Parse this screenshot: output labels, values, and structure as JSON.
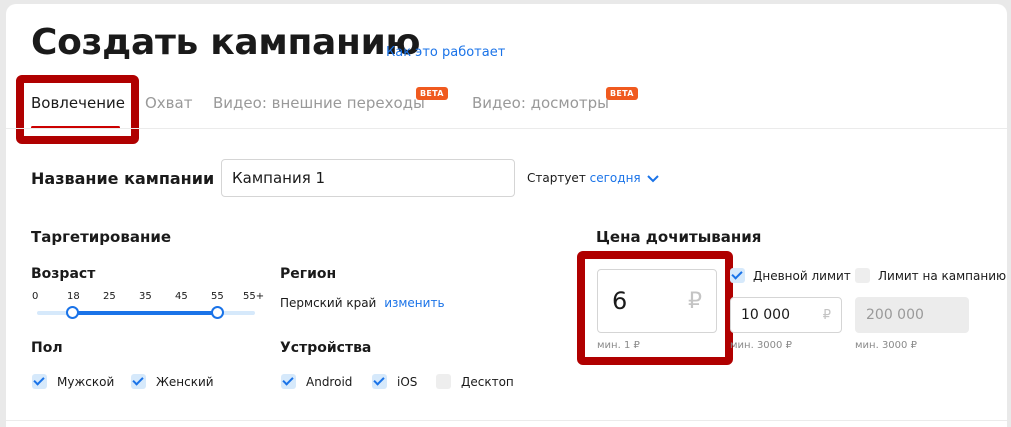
{
  "header": {
    "title": "Создать кампанию",
    "how_it_works": "Как это работает"
  },
  "tabs": [
    {
      "label": "Вовлечение",
      "active": true
    },
    {
      "label": "Охват"
    },
    {
      "label": "Видео: внешние переходы",
      "badge": "BETA"
    },
    {
      "label": "Видео: досмотры",
      "badge": "BETA"
    }
  ],
  "campaign": {
    "name_label": "Название кампании",
    "name_value": "Кампания 1",
    "starts_label": "Стартует",
    "starts_value": "сегодня"
  },
  "targeting": {
    "title": "Таргетирование",
    "age": {
      "label": "Возраст",
      "ticks": [
        "0",
        "18",
        "25",
        "35",
        "45",
        "55",
        "55+"
      ],
      "selected_min": "18",
      "selected_max": "55"
    },
    "region": {
      "label": "Регион",
      "value": "Пермский край",
      "change": "изменить"
    },
    "gender": {
      "label": "Пол",
      "options": [
        {
          "label": "Мужской",
          "checked": true
        },
        {
          "label": "Женский",
          "checked": true
        }
      ]
    },
    "devices": {
      "label": "Устройства",
      "options": [
        {
          "label": "Android",
          "checked": true
        },
        {
          "label": "iOS",
          "checked": true
        },
        {
          "label": "Десктоп",
          "checked": false
        }
      ]
    }
  },
  "price": {
    "title": "Цена дочитывания",
    "value": "6",
    "currency": "₽",
    "min_hint": "мин. 1 ₽",
    "daily_limit": {
      "label": "Дневной лимит",
      "checked": true,
      "value": "10 000",
      "min_hint": "мин. 3000 ₽"
    },
    "campaign_limit": {
      "label": "Лимит на кампанию",
      "checked": false,
      "value": "200 000",
      "min_hint": "мин. 3000 ₽"
    }
  },
  "colors": {
    "accent": "#1a73e8",
    "highlight": "#b00000",
    "beta": "#f05a1f"
  }
}
